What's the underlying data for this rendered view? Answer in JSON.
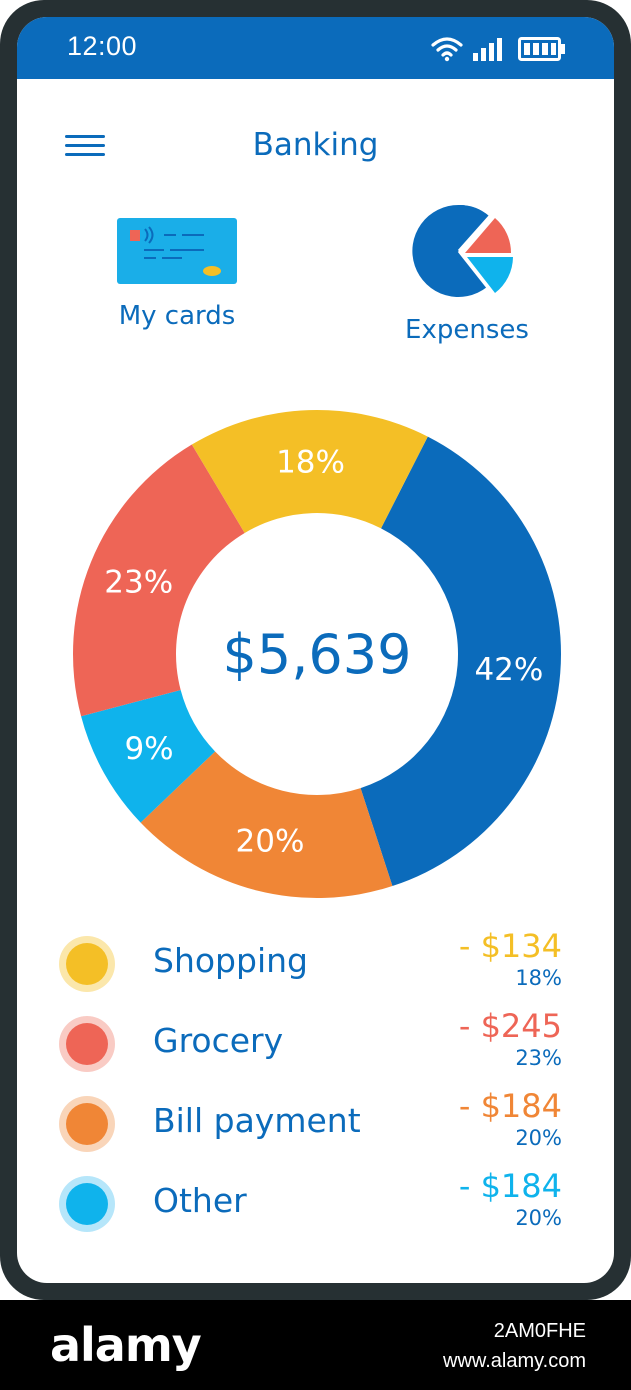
{
  "status_bar": {
    "time": "12:00",
    "icons": [
      "wifi-icon",
      "signal-icon",
      "battery-icon"
    ]
  },
  "header": {
    "title": "Banking",
    "menu_icon": "hamburger-menu-icon"
  },
  "quick_actions": [
    {
      "label": "My cards",
      "icon": "credit-card-icon"
    },
    {
      "label": "Expenses",
      "icon": "pie-chart-icon"
    }
  ],
  "total": "$5,639",
  "chart_data": {
    "type": "pie",
    "values": [
      42,
      20,
      9,
      23,
      18
    ],
    "labels": [
      "42%",
      "20%",
      "9%",
      "23%",
      "18%"
    ],
    "colors": [
      "#0b6bbb",
      "#f08636",
      "#0fb3ec",
      "#ee6556",
      "#f4bf26"
    ]
  },
  "legend": [
    {
      "name": "Shopping",
      "amount": "- $134",
      "percent": "18%",
      "color": "#f4bf26",
      "ring": "#fbe7ab"
    },
    {
      "name": "Grocery",
      "amount": "- $245",
      "percent": "23%",
      "color": "#ee6556",
      "ring": "#f9cbc4"
    },
    {
      "name": "Bill payment",
      "amount": "- $184",
      "percent": "20%",
      "color": "#f08636",
      "ring": "#f9d5b9"
    },
    {
      "name": "Other",
      "amount": "- $184",
      "percent": "20%",
      "color": "#0fb3ec",
      "ring": "#b6e6fa"
    }
  ],
  "colors": {
    "primary": "#0b6bbb",
    "frame": "#263033",
    "screen": "#ffffff"
  },
  "watermark": {
    "logo": "alamy",
    "image_id": "2AM0FHE",
    "url": "www.alamy.com"
  }
}
